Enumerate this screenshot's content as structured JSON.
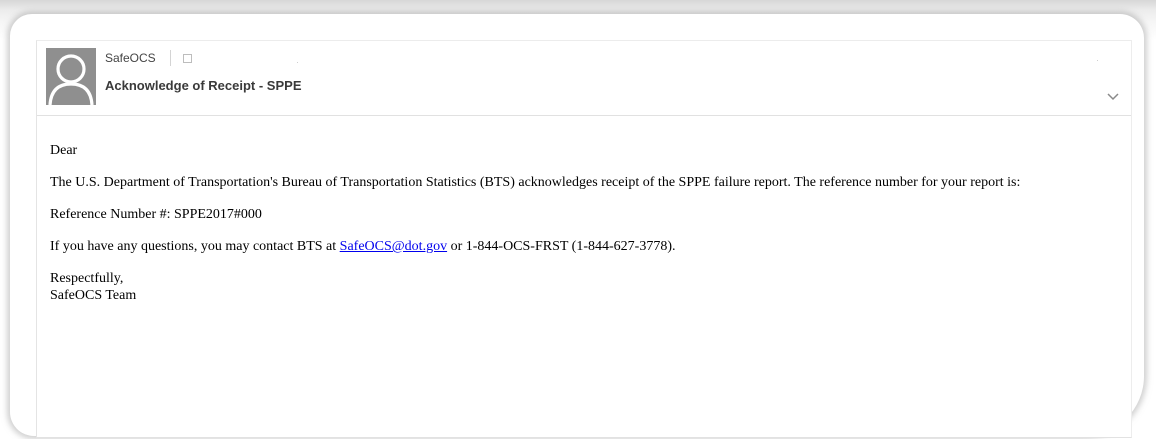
{
  "header": {
    "sender": "SafeOCS",
    "subject": "Acknowledge of Receipt - SPPE"
  },
  "icons": {
    "avatar": "person-silhouette-icon",
    "flag": "checkbox-square-icon",
    "expand": "chevron-down-icon"
  },
  "colors": {
    "avatar_bg": "#8f8f8f",
    "link": "#0000ee",
    "text": "#000000"
  },
  "body": {
    "greeting": "Dear",
    "intro": "The U.S. Department of Transportation's Bureau of Transportation Statistics (BTS) acknowledges receipt of the SPPE failure report. The reference number for your report is:",
    "reference": "Reference Number #: SPPE2017#000",
    "contact_prefix": "If you have any questions, you may contact BTS at ",
    "contact_email": "SafeOCS@dot.gov",
    "contact_suffix": " or 1-844-OCS-FRST (1-844-627-3778).",
    "closing": "Respectfully,",
    "signature": "SafeOCS Team"
  }
}
